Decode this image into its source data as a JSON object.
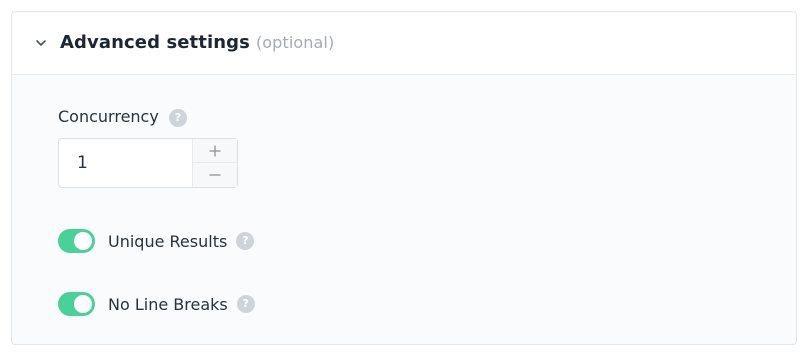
{
  "section": {
    "title": "Advanced settings",
    "optional_hint": "(optional)",
    "expanded": true
  },
  "concurrency": {
    "label": "Concurrency",
    "value": "1",
    "increment_symbol": "+",
    "decrement_symbol": "−"
  },
  "toggles": [
    {
      "label": "Unique Results",
      "enabled": true
    },
    {
      "label": "No Line Breaks",
      "enabled": true
    }
  ],
  "help_glyph": "?",
  "colors": {
    "toggle_on": "#4bd09a",
    "title_text": "#1c2733",
    "hint_text": "#a3abb4",
    "help_icon": "#cfd4da"
  }
}
